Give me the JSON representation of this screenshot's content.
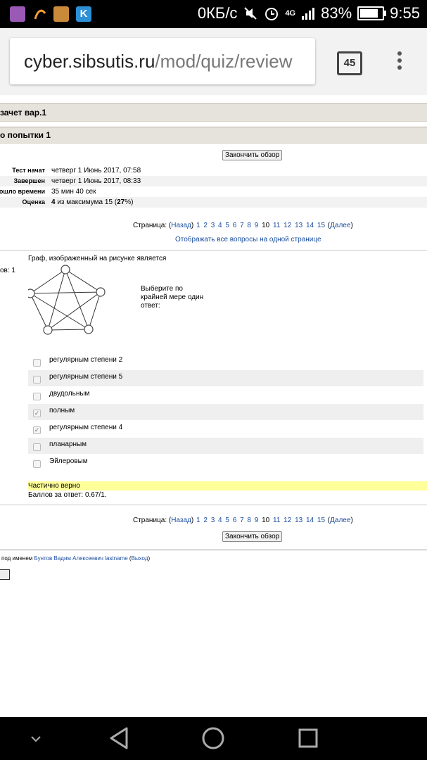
{
  "statusbar": {
    "speed": "0КБ/с",
    "network": "4G",
    "battery": "83%",
    "time": "9:55",
    "battery_level": 0.83
  },
  "browser": {
    "url_host": "cyber.sibsutis.ru",
    "url_path": "/mod/quiz/review",
    "tab_count": "45"
  },
  "quiz": {
    "header_title": "зачет вар.1",
    "attempt_title": "о попытки 1",
    "finish_review_label": "Закончить обзор",
    "info": [
      {
        "label": "Тест начат",
        "value": "четверг 1 Июнь 2017, 07:58"
      },
      {
        "label": "Завершен",
        "value": "четверг 1 Июнь 2017, 08:33"
      },
      {
        "label": "ошло времени",
        "value": "35 мин 40 сек"
      }
    ],
    "grade": {
      "label": "Оценка",
      "score": "4",
      "mid": " из максимума 15 (",
      "percent": "27",
      "end": "%)"
    },
    "pager": {
      "prefix": "Страница: (",
      "back": "Назад",
      "pages": [
        "1",
        "2",
        "3",
        "4",
        "5",
        "6",
        "7",
        "8",
        "9",
        "10",
        "11",
        "12",
        "13",
        "14",
        "15"
      ],
      "current": "10",
      "next": "Далее",
      "close": ")"
    },
    "show_all_link": "Отображать все вопросы на одной странице",
    "question": {
      "points_label": "ов: 1",
      "text": "Граф, изображенный на рисунке является",
      "prompt": "Выберите по крайней мере один ответ:",
      "options": [
        {
          "label": "регулярным степени 2",
          "checked": false
        },
        {
          "label": "регулярным степени 5",
          "checked": false
        },
        {
          "label": "двудольным",
          "checked": false
        },
        {
          "label": "полным",
          "checked": true
        },
        {
          "label": "регулярным степени 4",
          "checked": true
        },
        {
          "label": "планарным",
          "checked": false
        },
        {
          "label": "Эйлеровым",
          "checked": false
        }
      ],
      "feedback": "Частично верно",
      "score_text": "Баллов за ответ: 0.67/1."
    },
    "footer": {
      "login_prefix": "под именем ",
      "user_link": "Бунтов Вадим Алексеевич lastname",
      "logout_open": " (",
      "logout_link": "Выход",
      "logout_close": ")"
    },
    "feedback_color": "#ffff99",
    "link_color": "#1a4ea0"
  }
}
